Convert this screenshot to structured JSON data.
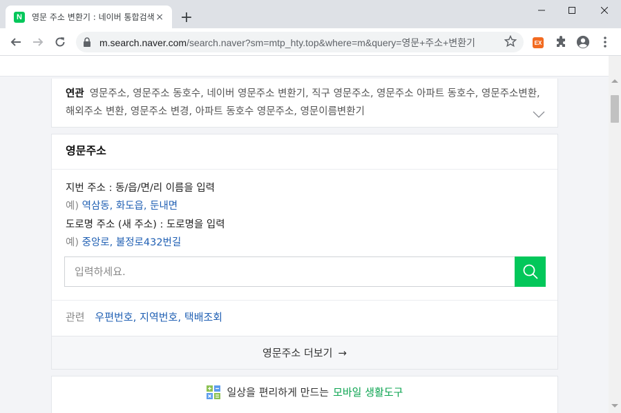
{
  "browser": {
    "tab_title": "영문 주소 변환기 : 네이버 통합검색",
    "favicon_letter": "N",
    "tab_close": "×",
    "new_tab": "+",
    "url_host": "m.search.naver.com",
    "url_path": "/search.naver?sm=mtp_hty.top&where=m&query=영문+주소+변환기",
    "ext_label": "EX"
  },
  "related": {
    "label": "연관",
    "text": "영문주소, 영문주소 동호수, 네이버 영문주소 변환기, 직구 영문주소, 영문주소 아파트 동호수, 영문주소변환, 해외주소 변환, 영문주소 변경, 아파트 동호수 영문주소, 영문이름변환기"
  },
  "converter": {
    "title": "영문주소",
    "lot_instruction": "지번 주소 : 동/읍/면/리 이름을 입력",
    "example_prefix": "예)",
    "lot_examples": [
      "역삼동",
      "화도읍",
      "둔내면"
    ],
    "road_instruction": "도로명 주소 (새 주소) : 도로명을 입력",
    "road_examples": [
      "중앙로",
      "불정로432번길"
    ],
    "placeholder": "입력하세요.",
    "related_label": "관련",
    "related_links": [
      "우편번호",
      "지역번호",
      "택배조회"
    ],
    "more_label": "영문주소 더보기",
    "more_arrow": "→"
  },
  "banner": {
    "text": "일상을 편리하게 만드는",
    "highlight": "모바일 생활도구"
  },
  "colors": {
    "naver_green": "#03c75a",
    "link_blue": "#1f5fb3",
    "highlight_green": "#0aa34f"
  }
}
